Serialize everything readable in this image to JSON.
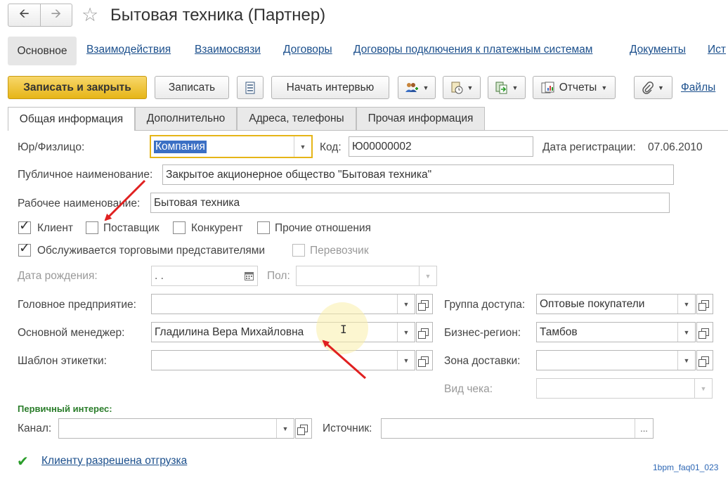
{
  "window": {
    "back_icon": "arrow-left",
    "forward_icon": "arrow-right",
    "title": "Бытовая техника (Партнер)"
  },
  "sections": {
    "active": "Основное",
    "links": [
      "Взаимодействия",
      "Взаимосвязи",
      "Договоры",
      "Договоры подключения к платежным системам",
      "Документы",
      "Ист"
    ]
  },
  "toolbar": {
    "save_close": "Записать и закрыть",
    "save": "Записать",
    "start_interview": "Начать интервью",
    "reports": "Отчеты",
    "files": "Файлы"
  },
  "tabs": [
    "Общая информация",
    "Дополнительно",
    "Адреса, телефоны",
    "Прочая информация"
  ],
  "form": {
    "legal_type_label": "Юр/Физлицо:",
    "legal_type_value": "Компания",
    "code_label": "Код:",
    "code_value": "Ю00000002",
    "reg_date_label": "Дата регистрации:",
    "reg_date_value": "07.06.2010",
    "public_name_label": "Публичное наименование:",
    "public_name_value": "Закрытое акционерное общество \"Бытовая техника\"",
    "work_name_label": "Рабочее наименование:",
    "work_name_value": "Бытовая техника",
    "cb_client": "Клиент",
    "cb_supplier": "Поставщик",
    "cb_competitor": "Конкурент",
    "cb_other": "Прочие отношения",
    "cb_trade_reps": "Обслуживается торговыми представителями",
    "cb_carrier": "Перевозчик",
    "birth_date_label": "Дата рождения:",
    "birth_date_value": " .  .",
    "gender_label": "Пол:",
    "head_company_label": "Головное предприятие:",
    "access_group_label": "Группа доступа:",
    "access_group_value": "Оптовые покупатели",
    "main_manager_label": "Основной менеджер:",
    "main_manager_value": "Гладилина Вера Михайловна",
    "business_region_label": "Бизнес-регион:",
    "business_region_value": "Тамбов",
    "label_template_label": "Шаблон этикетки:",
    "delivery_zone_label": "Зона доставки:",
    "receipt_type_label": "Вид чека:",
    "primary_interest_title": "Первичный интерес:",
    "channel_label": "Канал:",
    "source_label": "Источник:",
    "source_button": "..."
  },
  "shipment_link": "Клиенту разрешена отгрузка",
  "watermark": "1bpm_faq01_023",
  "colors": {
    "primary_button": "#e6b517",
    "link": "#1b4f8c",
    "annotation_arrow": "#e02020",
    "allowed_check": "#2a9d2a",
    "primary_interest_title": "#2a7d2a"
  }
}
